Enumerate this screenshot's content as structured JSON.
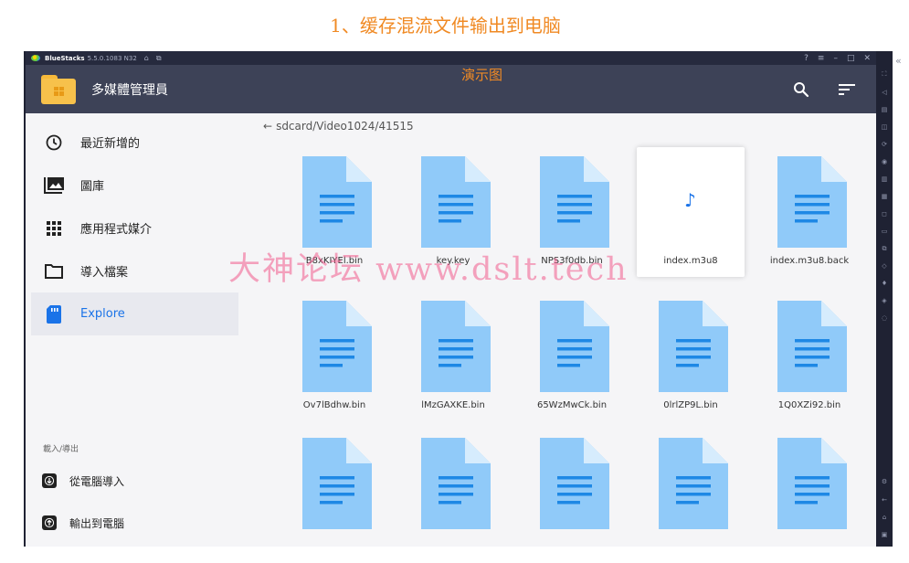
{
  "caption": "1、缓存混流文件输出到电脑",
  "titlebar": {
    "app_name": "BlueStacks",
    "version": "5.5.0.1083 N32",
    "icons": [
      "home-icon",
      "multi-instance-icon"
    ],
    "window_controls": [
      "help-icon",
      "menu-icon",
      "minimize-icon",
      "restore-icon",
      "close-icon"
    ]
  },
  "appbar": {
    "title": "多媒體管理員",
    "actions": [
      "search-icon",
      "sort-icon"
    ]
  },
  "sidebar": {
    "items": [
      {
        "label": "最近新增的",
        "icon": "clock-icon"
      },
      {
        "label": "圖庫",
        "icon": "gallery-icon"
      },
      {
        "label": "應用程式媒介",
        "icon": "apps-grid-icon"
      },
      {
        "label": "導入檔案",
        "icon": "folder-icon"
      },
      {
        "label": "Explore",
        "icon": "sd-card-icon",
        "active": true
      }
    ],
    "section_label": "載入/導出",
    "sub_items": [
      {
        "label": "從電腦導入",
        "icon": "import-icon"
      },
      {
        "label": "輸出到電腦",
        "icon": "export-icon"
      }
    ]
  },
  "main": {
    "breadcrumb_arrow": "←",
    "path": "sdcard/Video1024/41515",
    "annotation": "演示图",
    "files": [
      {
        "name": "B8xKIYEl.bin",
        "type": "doc"
      },
      {
        "name": "key.key",
        "type": "doc"
      },
      {
        "name": "NPS3f0db.bin",
        "type": "doc"
      },
      {
        "name": "index.m3u8",
        "type": "audio",
        "selected": true
      },
      {
        "name": "index.m3u8.back",
        "type": "doc"
      },
      {
        "name": "Ov7lBdhw.bin",
        "type": "doc"
      },
      {
        "name": "lMzGAXKE.bin",
        "type": "doc"
      },
      {
        "name": "65WzMwCk.bin",
        "type": "doc"
      },
      {
        "name": "0lrlZP9L.bin",
        "type": "doc"
      },
      {
        "name": "1Q0XZi92.bin",
        "type": "doc"
      },
      {
        "name": "",
        "type": "doc"
      },
      {
        "name": "",
        "type": "doc"
      },
      {
        "name": "",
        "type": "doc"
      },
      {
        "name": "",
        "type": "doc"
      },
      {
        "name": "",
        "type": "doc"
      }
    ]
  },
  "watermark": "大神论坛  www.dslt.tech",
  "colors": {
    "accent": "#1a73e8",
    "appbar": "#3d4257",
    "titlebar": "#262a3e",
    "doc_icon": "#90caf9",
    "doc_lines": "#1e88e5",
    "caption": "#f08a24"
  }
}
